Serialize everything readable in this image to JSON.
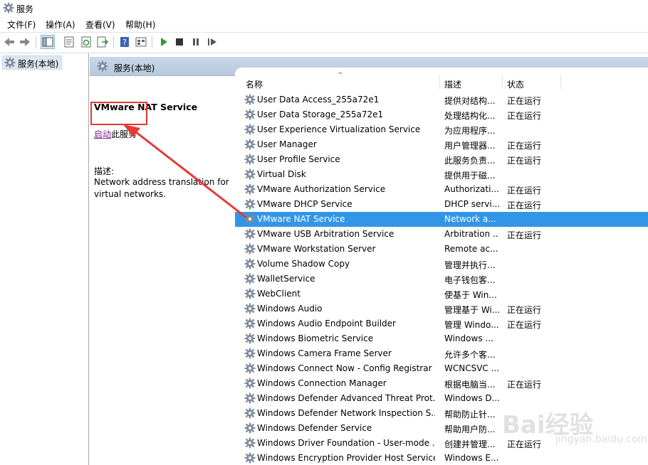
{
  "window": {
    "title": "服务"
  },
  "menu": [
    "文件(F)",
    "操作(A)",
    "查看(V)",
    "帮助(H)"
  ],
  "toolbar": [
    "back-icon",
    "forward-icon",
    "show-hide-tree-icon",
    "properties-icon",
    "refresh-icon",
    "export-icon",
    "help-icon",
    "view-icon",
    "start-icon",
    "stop-icon",
    "pause-icon",
    "restart-icon"
  ],
  "tree": {
    "node": "服务(本地)"
  },
  "panel": {
    "header": "服务(本地)"
  },
  "extended": {
    "service_name": "VMware NAT Service",
    "start_link": "启动",
    "start_suffix": "此服务",
    "desc_label": "描述:",
    "desc_text": "Network address translation for virtual networks."
  },
  "columns": {
    "name": "名称",
    "desc": "描述",
    "status": "状态"
  },
  "services": [
    {
      "name": "User Data Access_255a72e1",
      "desc": "提供对结构...",
      "status": "正在运行"
    },
    {
      "name": "User Data Storage_255a72e1",
      "desc": "处理结构化...",
      "status": "正在运行"
    },
    {
      "name": "User Experience Virtualization Service",
      "desc": "为应用程序...",
      "status": ""
    },
    {
      "name": "User Manager",
      "desc": "用户管理器...",
      "status": "正在运行"
    },
    {
      "name": "User Profile Service",
      "desc": "此服务负责...",
      "status": "正在运行"
    },
    {
      "name": "Virtual Disk",
      "desc": "提供用于磁...",
      "status": ""
    },
    {
      "name": "VMware Authorization Service",
      "desc": "Authorizati...",
      "status": "正在运行"
    },
    {
      "name": "VMware DHCP Service",
      "desc": "DHCP servi...",
      "status": "正在运行"
    },
    {
      "name": "VMware NAT Service",
      "desc": "Network a...",
      "status": "",
      "selected": true
    },
    {
      "name": "VMware USB Arbitration Service",
      "desc": "Arbitration ...",
      "status": "正在运行"
    },
    {
      "name": "VMware Workstation Server",
      "desc": "Remote ac...",
      "status": ""
    },
    {
      "name": "Volume Shadow Copy",
      "desc": "管理并执行...",
      "status": ""
    },
    {
      "name": "WalletService",
      "desc": "电子钱包客...",
      "status": ""
    },
    {
      "name": "WebClient",
      "desc": "使基于 Win...",
      "status": ""
    },
    {
      "name": "Windows Audio",
      "desc": "管理基于 Wi...",
      "status": "正在运行"
    },
    {
      "name": "Windows Audio Endpoint Builder",
      "desc": "管理 Windo...",
      "status": "正在运行"
    },
    {
      "name": "Windows Biometric Service",
      "desc": "Windows ...",
      "status": ""
    },
    {
      "name": "Windows Camera Frame Server",
      "desc": "允许多个客...",
      "status": ""
    },
    {
      "name": "Windows Connect Now - Config Registrar",
      "desc": "WCNCSVC ...",
      "status": ""
    },
    {
      "name": "Windows Connection Manager",
      "desc": "根据电脑当...",
      "status": "正在运行"
    },
    {
      "name": "Windows Defender Advanced Threat Prot...",
      "desc": "Windows D...",
      "status": ""
    },
    {
      "name": "Windows Defender Network Inspection S...",
      "desc": "帮助防止针...",
      "status": ""
    },
    {
      "name": "Windows Defender Service",
      "desc": "帮助用户防...",
      "status": ""
    },
    {
      "name": "Windows Driver Foundation - User-mode ...",
      "desc": "创建并管理...",
      "status": "正在运行"
    },
    {
      "name": "Windows Encryption Provider Host Service",
      "desc": "Windows E...",
      "status": ""
    }
  ],
  "colors": {
    "selection": "#3296e8",
    "annotation": "#e53935",
    "link": "#7a1f8f",
    "header_bg": "#c9d7e8"
  },
  "watermark": {
    "brand": "Bai经验",
    "sub": "jingyan.baidu.com"
  }
}
